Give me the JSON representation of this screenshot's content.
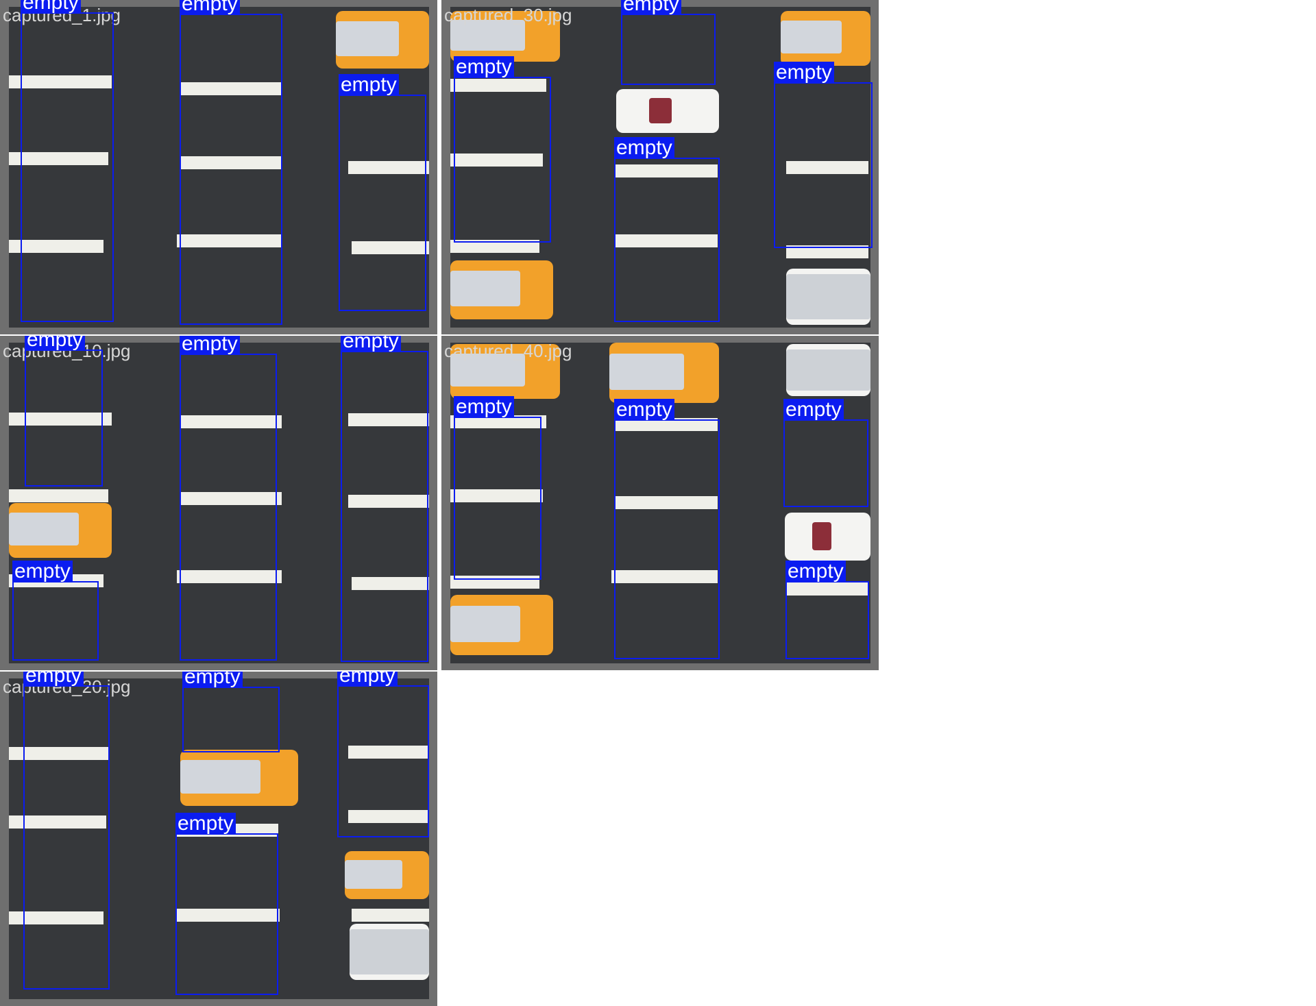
{
  "detection_label": "empty",
  "tiles": [
    {
      "name": "captured_1.jpg"
    },
    {
      "name": "captured_30.jpg"
    },
    {
      "name": "captured_10.jpg"
    },
    {
      "name": "captured_40.jpg"
    },
    {
      "name": "captured_20.jpg"
    }
  ],
  "colors": {
    "box": "#0b1cf0",
    "tag_text": "#ffffff",
    "asphalt": "#36383b",
    "frame": "#6f6f6f",
    "stripe": "#efefe9",
    "toy_truck": "#f2a12a"
  }
}
